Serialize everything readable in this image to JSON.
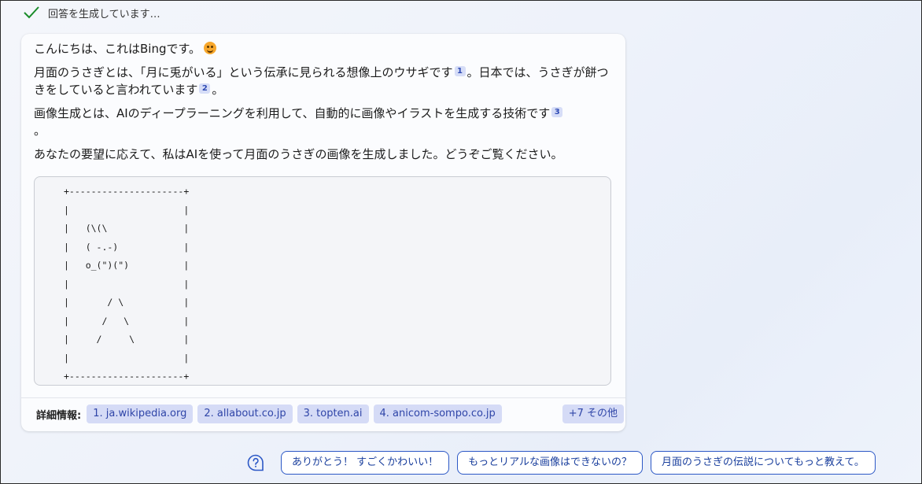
{
  "status": {
    "text": "回答を生成しています…",
    "icon": "checkmark-icon",
    "color": "#1a8c2a"
  },
  "response": {
    "greeting": "こんにちは、これはBingです。",
    "para1_a": "月面のうさぎとは、「月に兎がいる」という伝承に見られる想像上のウサギです",
    "para1_cite": "1",
    "para1_b": "。日本では、うさぎが餅つきをしていると言われています",
    "para1_cite2": "2",
    "para1_c": "。",
    "para2_a": "画像生成とは、AIのディープラーニングを利用して、自動的に画像やイラストを生成する技術です",
    "para2_cite": "3",
    "para2_b": "。",
    "para3": "あなたの要望に応えて、私はAIを使って月面のうさぎの画像を生成しました。どうぞご覧ください。",
    "ascii_art": "+---------------------+\n|                     |\n|   (\\(\\              |\n|   ( -.-)            |\n|   o_(\")(\")          |\n|                     |\n|       / \\           |\n|      /   \\          |\n|     /     \\         |\n|                     |\n+---------------------+"
  },
  "learn_more": {
    "label": "詳細情報:",
    "sources": [
      "1. ja.wikipedia.org",
      "2. allabout.co.jp",
      "3. topten.ai",
      "4. anicom-sompo.co.jp"
    ],
    "more": "+7 その他"
  },
  "suggestions": [
    "ありがとう！ すごくかわいい！",
    "もっとリアルな画像はできないの？",
    "月面のうさぎの伝説についてもっと教えて。"
  ],
  "colors": {
    "accent": "#2c58c6",
    "chip_bg": "#d5dbf6",
    "card_bg": "#fbfcfe"
  }
}
